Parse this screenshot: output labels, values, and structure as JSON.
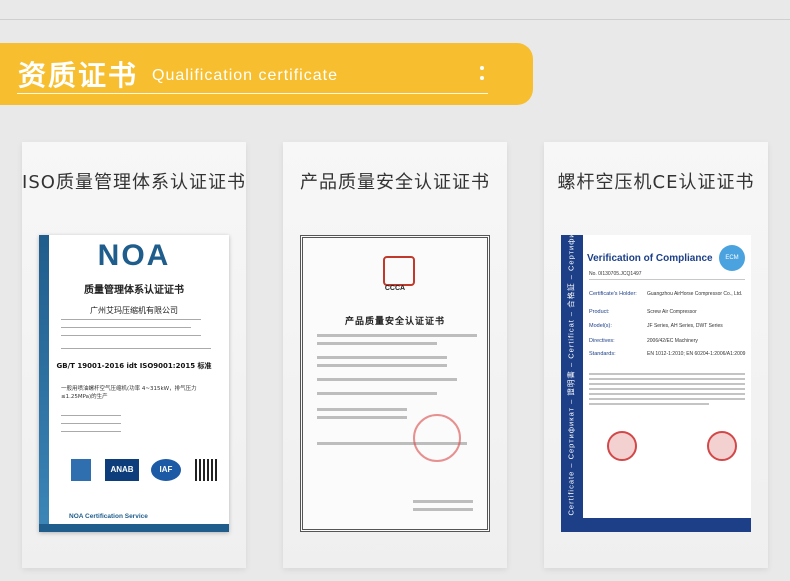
{
  "header": {
    "title": "资质证书",
    "subtitle": "Qualification certificate",
    "menu_icon": "more-vertical-icon",
    "accent_color": "#f7bf2f"
  },
  "cards": [
    {
      "title": "ISO质量管理体系认证证书",
      "cert": {
        "logo": "NOA",
        "heading": "质量管理体系认证证书",
        "company": "广州艾玛压缩机有限公司",
        "standard": "GB/T 19001-2016 idt ISO9001:2015 标准",
        "scope": "一般用喷油螺杆空气压缩机(功率 4~315kW，排气压力≤1.25MPa)的生产",
        "badges": [
          "ANAB",
          "IAF"
        ],
        "service": "NOA Certification Service"
      }
    },
    {
      "title": "产品质量安全认证证书",
      "cert": {
        "logo": "CCCA",
        "heading": "产品质量安全认证证书"
      }
    },
    {
      "title": "螺杆空压机CE认证证书",
      "cert": {
        "heading": "Verification of Compliance",
        "badge": "ECM",
        "number": "No. 0I130705.JCQ1497",
        "side_text": "Certificate – Сертификат – 證明書 – Certificat – 合格証 – Сертификат",
        "rows": [
          {
            "label": "Certificate's Holder:",
            "value": "Guangzhou AirHorse Compressor Co., Ltd."
          },
          {
            "label": "Product:",
            "value": "Screw Air Compressor"
          },
          {
            "label": "Model(s):",
            "value": "JF Series, AH Series, DWT Series"
          },
          {
            "label": "Directives:",
            "value": "2006/42/EC Machinery"
          },
          {
            "label": "Standards:",
            "value": "EN 1012-1:2010; EN 60204-1:2006/A1:2009"
          }
        ]
      }
    }
  ]
}
